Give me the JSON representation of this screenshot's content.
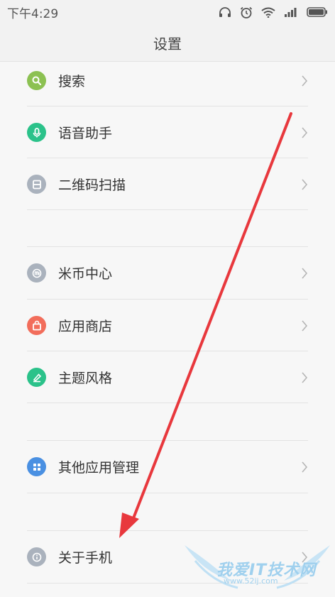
{
  "status_bar": {
    "time": "下午4:29",
    "icons": [
      "headphone-icon",
      "alarm-icon",
      "wifi-icon",
      "signal-icon",
      "battery-icon"
    ]
  },
  "header": {
    "title": "设置"
  },
  "items": [
    {
      "label": "搜索",
      "icon": "search-icon",
      "color": "#8cc152"
    },
    {
      "label": "语音助手",
      "icon": "microphone-icon",
      "color": "#2bc28a"
    },
    {
      "label": "二维码扫描",
      "icon": "qr-scan-icon",
      "color": "#aab2bd"
    },
    {
      "label": "米币中心",
      "icon": "mi-coin-icon",
      "color": "#aab2bd"
    },
    {
      "label": "应用商店",
      "icon": "store-bag-icon",
      "color": "#f26d5b"
    },
    {
      "label": "主题风格",
      "icon": "theme-brush-icon",
      "color": "#2bc28a"
    },
    {
      "label": "其他应用管理",
      "icon": "apps-grid-icon",
      "color": "#4a90e2"
    },
    {
      "label": "关于手机",
      "icon": "info-icon",
      "color": "#aab2bd"
    }
  ],
  "annotation": {
    "arrow_color": "#e8383d"
  },
  "watermark": {
    "text": "我爱IT技术网",
    "sub": "www.52ij.com"
  }
}
